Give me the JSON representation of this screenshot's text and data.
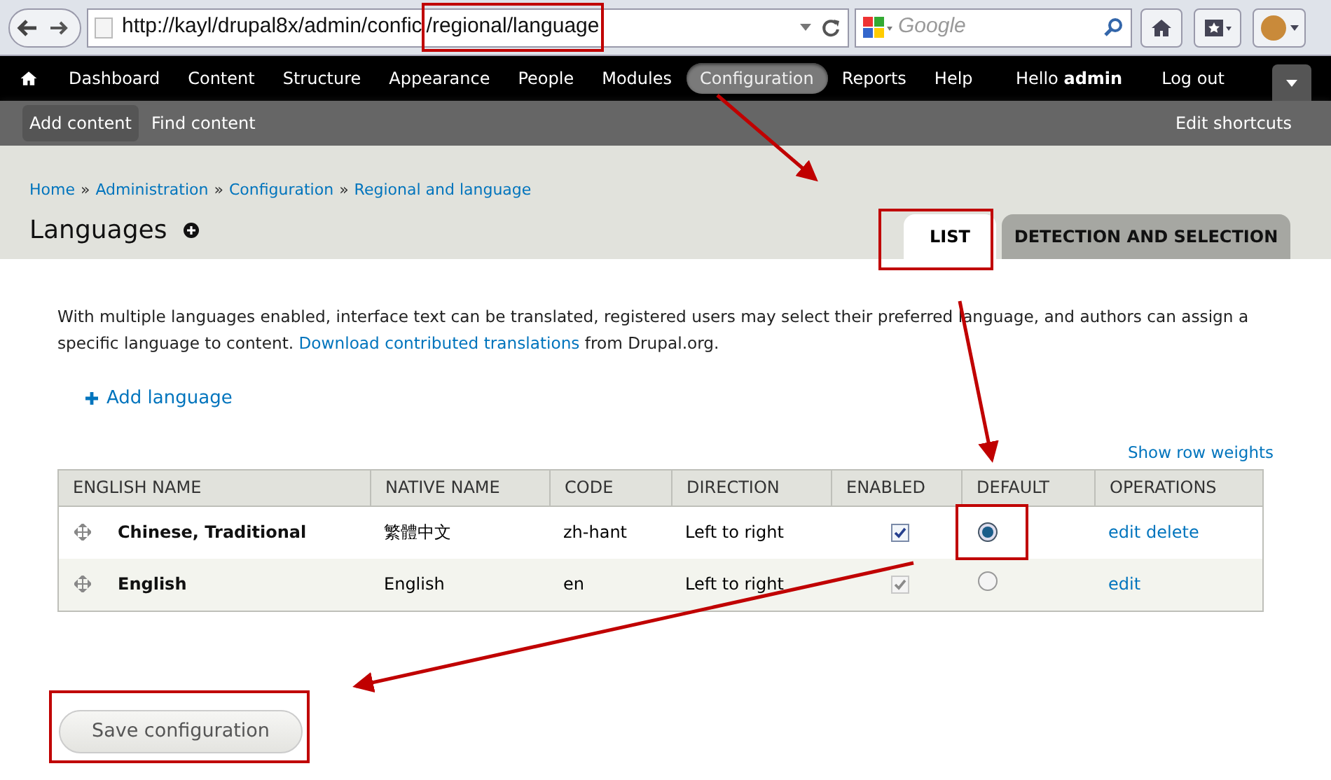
{
  "browser": {
    "url_prefix": "http://kayl/drupal8x/admin/confic",
    "url_highlight": "/regional/language",
    "search_placeholder": "Google"
  },
  "toolbar": {
    "items": [
      {
        "label": "Dashboard",
        "selected": false
      },
      {
        "label": "Content",
        "selected": false
      },
      {
        "label": "Structure",
        "selected": false
      },
      {
        "label": "Appearance",
        "selected": false
      },
      {
        "label": "People",
        "selected": false
      },
      {
        "label": "Modules",
        "selected": false
      },
      {
        "label": "Configuration",
        "selected": true
      },
      {
        "label": "Reports",
        "selected": false
      },
      {
        "label": "Help",
        "selected": false
      }
    ],
    "greeting": "Hello",
    "user": "admin",
    "logout": "Log out"
  },
  "shortcuts": {
    "items": [
      {
        "label": "Add content",
        "selected": true
      },
      {
        "label": "Find content",
        "selected": false
      }
    ],
    "edit": "Edit shortcuts"
  },
  "breadcrumb": [
    "Home",
    "Administration",
    "Configuration",
    "Regional and language"
  ],
  "breadcrumb_separator": "»",
  "page_title": "Languages",
  "tabs": [
    {
      "label": "LIST",
      "selected": true
    },
    {
      "label": "DETECTION AND SELECTION",
      "selected": false
    }
  ],
  "description": {
    "text": "With multiple languages enabled, interface text can be translated, registered users may select their preferred language, and authors can assign a specific language to content.",
    "link": "Download contributed translations",
    "after": "from Drupal.org."
  },
  "add_language": "Add language",
  "show_row_weights": "Show row weights",
  "table": {
    "columns": [
      "ENGLISH NAME",
      "NATIVE NAME",
      "CODE",
      "DIRECTION",
      "ENABLED",
      "DEFAULT",
      "OPERATIONS"
    ],
    "rows": [
      {
        "english_name": "Chinese, Traditional",
        "native_name": "繁體中文",
        "code": "zh-hant",
        "direction": "Left to right",
        "enabled": true,
        "enabled_disabled": false,
        "selected": true,
        "operations": [
          "edit",
          "delete"
        ]
      },
      {
        "english_name": "English",
        "native_name": "English",
        "code": "en",
        "direction": "Left to right",
        "enabled": true,
        "enabled_disabled": true,
        "selected": false,
        "operations": [
          "edit"
        ]
      }
    ]
  },
  "save_button": "Save configuration"
}
